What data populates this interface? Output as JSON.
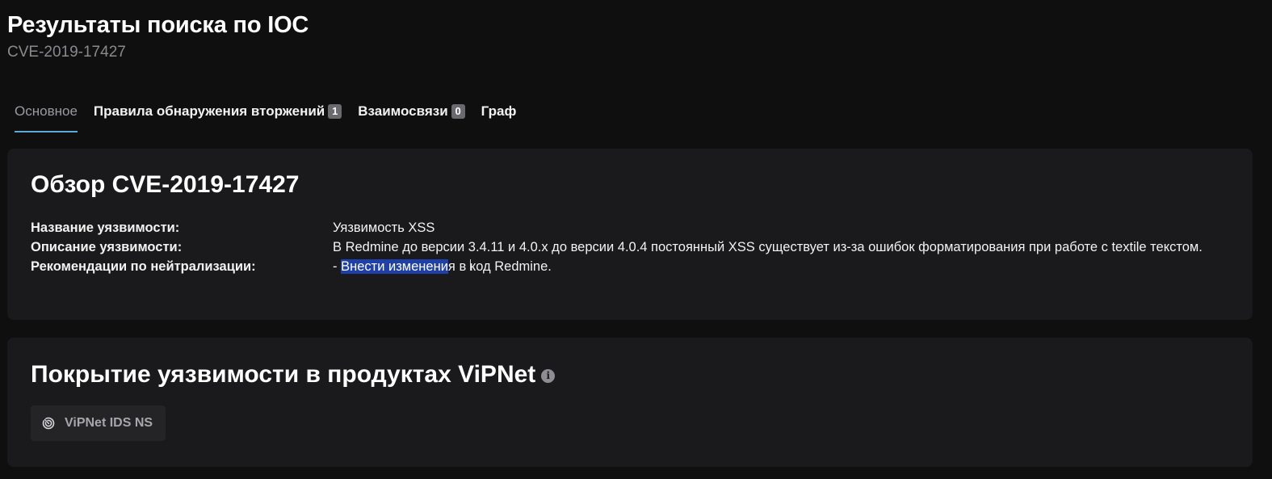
{
  "header": {
    "title": "Результаты поиска по IOC",
    "subtitle": "CVE-2019-17427"
  },
  "tabs": [
    {
      "label": "Основное",
      "active": true
    },
    {
      "label": "Правила обнаружения вторжений",
      "badge": "1"
    },
    {
      "label": "Взаимосвязи",
      "badge": "0"
    },
    {
      "label": "Граф"
    }
  ],
  "overview": {
    "title": "Обзор CVE-2019-17427",
    "fields": {
      "name_label": "Название уязвимости:",
      "name_value": "Уязвимость XSS",
      "description_label": "Описание уязвимости:",
      "description_value": "В Redmine до версии 3.4.11 и 4.0.x до версии 4.0.4 постоянный XSS существует из-за ошибок форматирования при работе с textile текстом.",
      "mitigation_label": "Рекомендации по нейтрализации:",
      "mitigation_prefix": "- ",
      "mitigation_selected": "Внести изменени",
      "mitigation_rest_a": "я в ",
      "mitigation_rest_b": "код Redmine."
    }
  },
  "coverage": {
    "title": "Покрытие уязвимости в продуктах ViPNet",
    "info_icon": "info-icon",
    "products": [
      {
        "label": "ViPNet IDS NS",
        "icon": "radar-icon"
      }
    ]
  },
  "colors": {
    "background": "#0f0f10",
    "card": "#1a1a1c",
    "tab_underline": "#5aa9d8",
    "selection": "#1e40a8"
  }
}
